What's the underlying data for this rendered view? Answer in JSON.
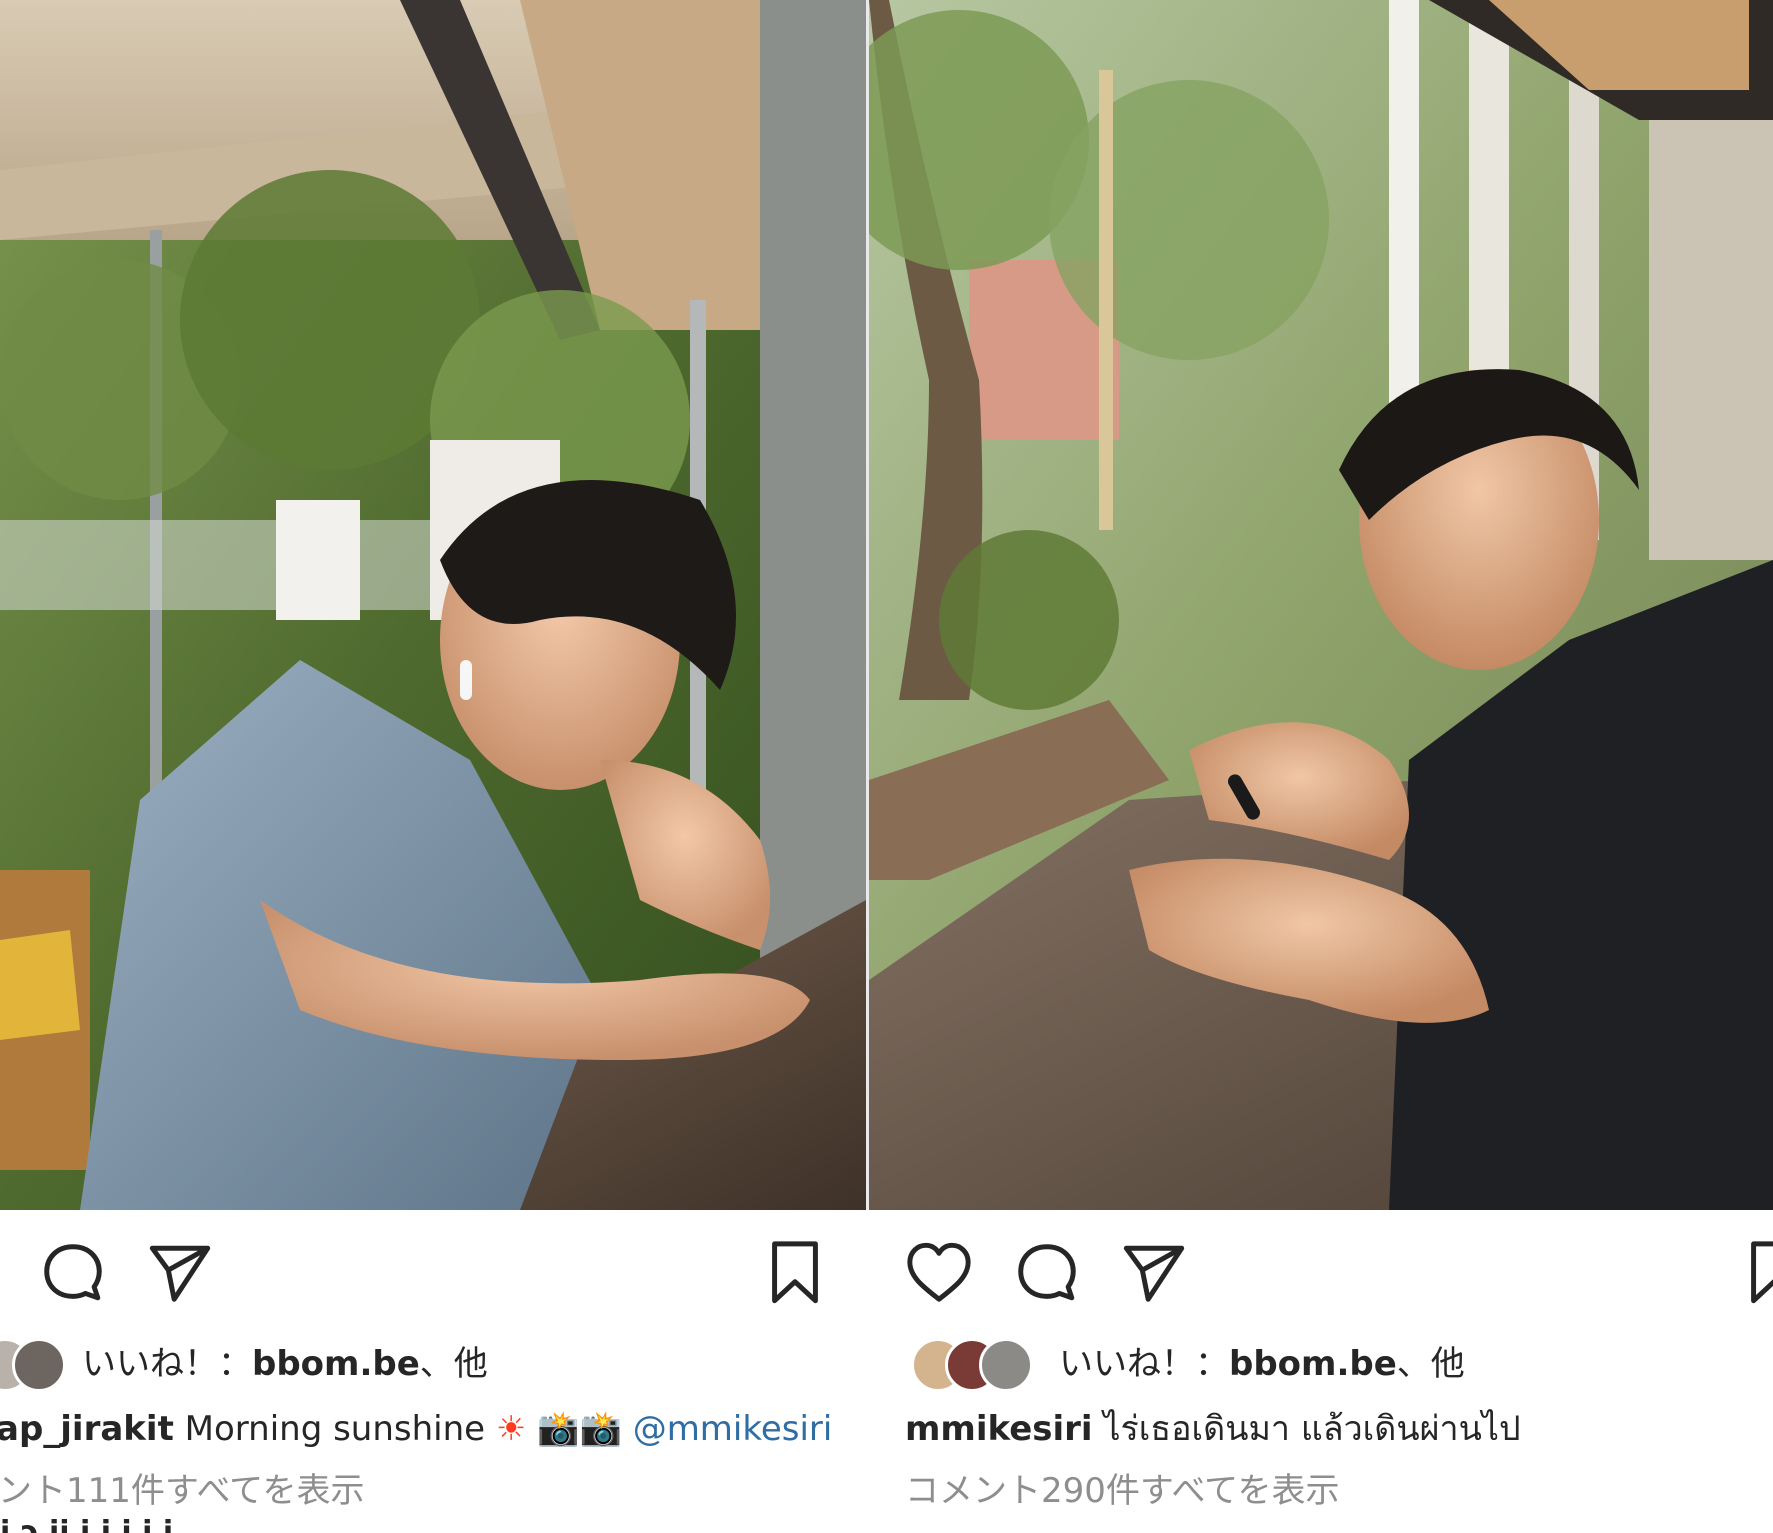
{
  "left_post": {
    "photo_alt": "",
    "actions": {
      "comment_icon": "comment-icon",
      "share_icon": "send-icon",
      "save_icon": "bookmark-icon"
    },
    "likes": {
      "prefix": "いいね！：",
      "user": "bbom.be",
      "suffix": "、他"
    },
    "caption": {
      "username": "ap_jirakit",
      "text": "Morning sunshine",
      "emoji_sun": "☀",
      "emoji_cameras": "📸📸",
      "mention": "@mmikesiri"
    },
    "view_comments": "ント111件すべてを表示",
    "next_comment_partial": "i ɔ ii i i i i i"
  },
  "right_post": {
    "photo_alt": "",
    "actions": {
      "like_icon": "heart-icon",
      "comment_icon": "comment-icon",
      "share_icon": "send-icon",
      "save_icon": "bookmark-icon"
    },
    "likes": {
      "prefix": "いいね！：",
      "user": "bbom.be",
      "suffix": "、他"
    },
    "caption": {
      "username": "mmikesiri",
      "text": "ไร่เธอเดินมา แล้วเดินผ่านไป"
    },
    "view_comments": "コメント290件すべてを表示"
  },
  "colors": {
    "text": "#262626",
    "muted": "#8e8e8e",
    "mention": "#2f6da3",
    "background": "#ffffff"
  }
}
